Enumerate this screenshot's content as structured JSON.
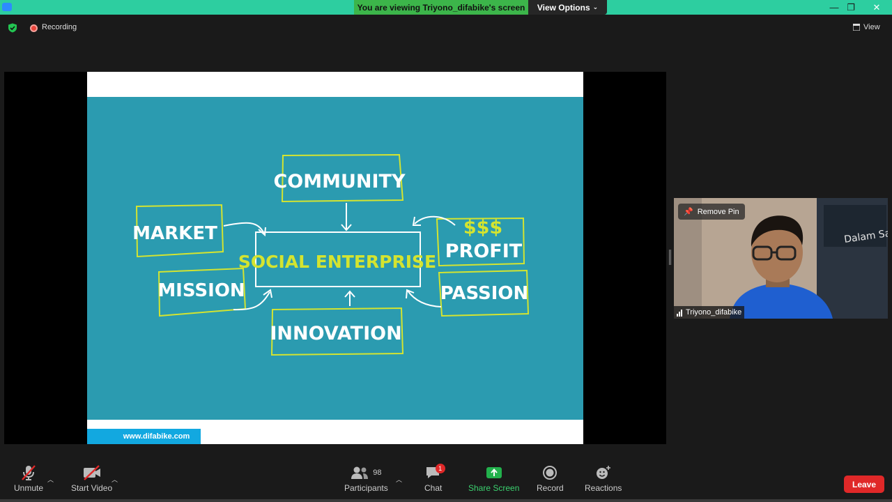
{
  "titlebar": {
    "banner": "You are viewing Triyono_difabike's screen",
    "view_options": "View Options",
    "close": "✕",
    "maximize": "❐",
    "minimize": "—"
  },
  "status": {
    "recording": "Recording",
    "view": "View"
  },
  "slide": {
    "labels": {
      "community": "COMMUNITY",
      "market": "MARKET",
      "social_enterprise": "SOCIAL ENTERPRISE",
      "dollars": "$$$",
      "profit": "PROFIT",
      "mission": "MISSION",
      "passion": "PASSION",
      "innovation": "INNOVATION"
    },
    "footer_url": "www.difabike.com"
  },
  "video": {
    "remove_pin": "Remove Pin",
    "participant_name": "Triyono_difabike",
    "poster_text": "Dalam Sat"
  },
  "toolbar": {
    "unmute": "Unmute",
    "start_video": "Start Video",
    "participants": "Participants",
    "participants_count": "98",
    "chat": "Chat",
    "chat_badge": "1",
    "share_screen": "Share Screen",
    "record": "Record",
    "reactions": "Reactions",
    "leave": "Leave"
  },
  "colors": {
    "zoom_green": "#2dcea0",
    "banner_green": "#3cb54a",
    "slide_teal": "#2b9bb0",
    "slide_yellow": "#d4e430",
    "leave_red": "#e02828",
    "share_green": "#22b14c"
  }
}
